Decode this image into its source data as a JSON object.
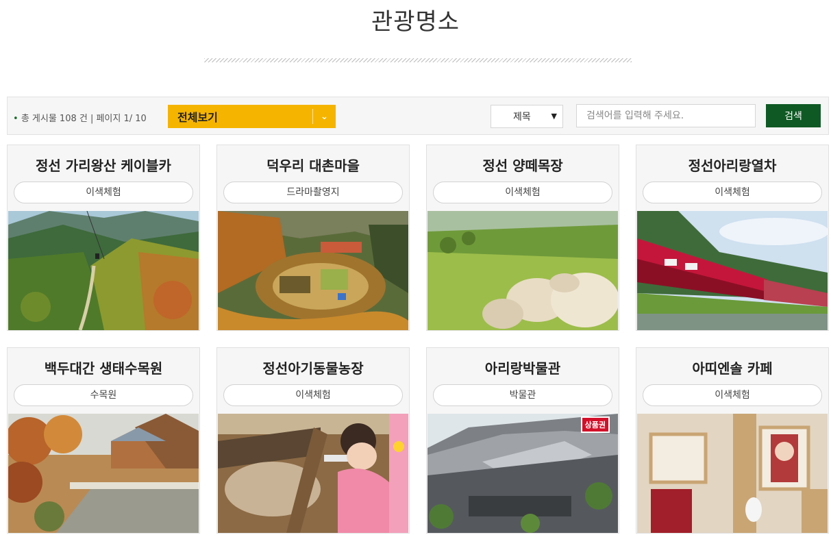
{
  "page": {
    "title": "관광명소"
  },
  "toolbar": {
    "post_info": "총 게시물 108 건 | 페이지 1/ 10",
    "category_selected": "전체보기",
    "field_selected": "제목",
    "search_placeholder": "검색어를 입력해 주세요.",
    "search_button": "검색"
  },
  "colors": {
    "accent_green": "#0f5a24",
    "accent_yellow": "#f5b400"
  },
  "cards": [
    {
      "title": "정선 가리왕산 케이블카",
      "tag": "이색체험",
      "photo": "mountain-cable-car"
    },
    {
      "title": "덕우리 대촌마을",
      "tag": "드라마촬영지",
      "photo": "aerial-village"
    },
    {
      "title": "정선 양떼목장",
      "tag": "이색체험",
      "photo": "sheep-farm"
    },
    {
      "title": "정선아리랑열차",
      "tag": "이색체험",
      "photo": "korail-train"
    },
    {
      "title": "백두대간 생태수목원",
      "tag": "수목원",
      "photo": "arboretum-cabins"
    },
    {
      "title": "정선아기동물농장",
      "tag": "이색체험",
      "photo": "child-feeding-animals"
    },
    {
      "title": "아리랑박물관",
      "tag": "박물관",
      "photo": "museum-building",
      "badge": "상품권"
    },
    {
      "title": "아띠엔솔 카페",
      "tag": "이색체험",
      "photo": "cafe-interior"
    }
  ]
}
